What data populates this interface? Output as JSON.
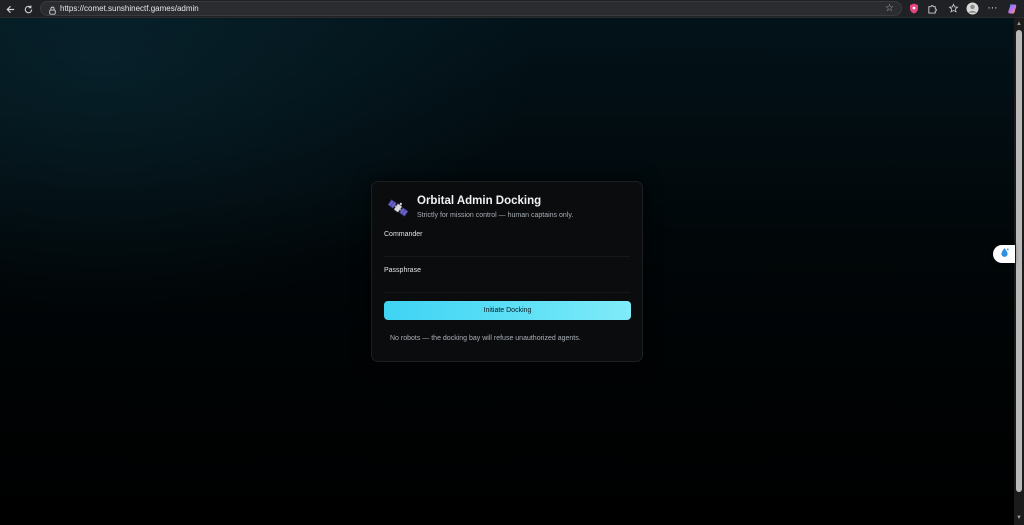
{
  "browser": {
    "url": "https://comet.sunshinectf.games/admin",
    "icons": {
      "back": "back-arrow-icon",
      "reload": "reload-icon",
      "lock": "lock-icon",
      "bookmark": "star-icon",
      "shield": "shield-extension-icon",
      "extensions": "puzzle-icon",
      "favorites": "favorites-icon",
      "profile": "profile-avatar-icon",
      "menu": "more-menu-icon",
      "copilot": "copilot-icon"
    }
  },
  "login": {
    "title": "Orbital Admin Docking",
    "subtitle": "Strictly for mission control — human captains only.",
    "commander_label": "Commander",
    "commander_value": "",
    "passphrase_label": "Passphrase",
    "passphrase_value": "",
    "button_label": "Initiate Docking",
    "notice": "No robots — the docking bay will refuse unauthorized agents.",
    "icon": "satellite-icon"
  },
  "colors": {
    "accent": "#3fd3f3",
    "accent_end": "#80ebf9",
    "card_bg": "#0b0c0e",
    "page_bg": "#000000"
  },
  "side_widget": {
    "icon": "water-drop-icon"
  }
}
